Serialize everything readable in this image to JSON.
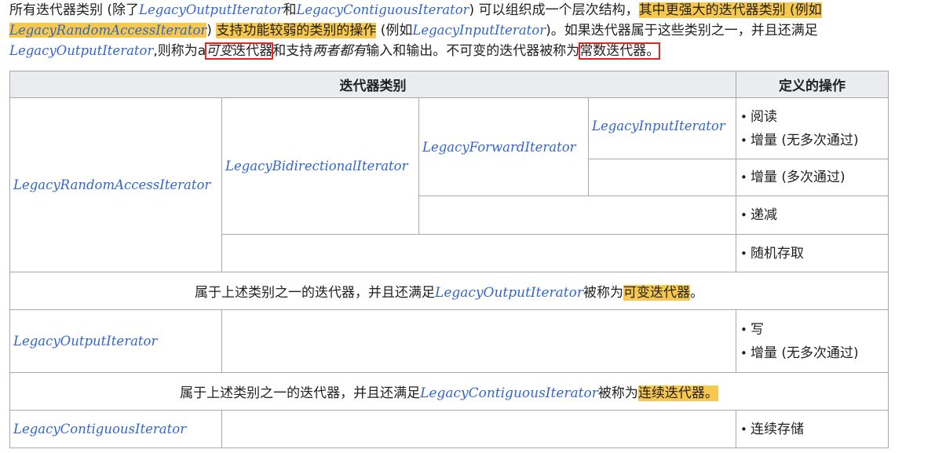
{
  "intro": {
    "t1": "所有迭代器类别 (除了",
    "l1": "LegacyOutputIterator",
    "t2": "和",
    "l2": "LegacyContiguousIterator",
    "t3": ") 可以组织成一个层次结构，",
    "h1": "其中更强大的迭代器类别 (例如",
    "l3": "LegacyRandomAccessIterator",
    "t4": ") ",
    "h2": "支持功能较弱的类别的操作",
    "t5": " (例如",
    "l4": "LegacyInputIterator",
    "t6": ")。如果迭代器属于这些类别之一，并且还满足",
    "l5": "LegacyOutputIterator",
    "t7": ",则称为a",
    "b1_italic": "可变",
    "b1_rest": "迭代器",
    "t8": "和支持",
    "i1": "两者都有",
    "t9": "输入和输出。不可变的迭代器被称为",
    "b2": "常数迭代器。"
  },
  "table": {
    "header_categories": "迭代器类别",
    "header_ops": "定义的操作",
    "random_access": "LegacyRandomAccessIterator",
    "bidirectional": "LegacyBidirectionalIterator",
    "forward": "LegacyForwardIterator",
    "input": "LegacyInputIterator",
    "ops_read": "阅读",
    "ops_inc_single": "增量 (无多次通过)",
    "ops_inc_multi": "增量 (多次通过)",
    "ops_dec": "递减",
    "ops_random": "随机存取",
    "mutable_row": {
      "pre": "属于上述类别之一的迭代器，并且还满足",
      "link": "LegacyOutputIterator",
      "mid": "被称为",
      "hl": "可变迭代器",
      "post": "。"
    },
    "output": "LegacyOutputIterator",
    "ops_write": "写",
    "ops_inc_single_2": "增量 (无多次通过)",
    "contig_row": {
      "pre": "属于上述类别之一的迭代器，并且还满足",
      "link": "LegacyContiguousIterator",
      "mid": "被称为",
      "hl": "连续迭代器。"
    },
    "contiguous": "LegacyContiguousIterator",
    "ops_contig": "连续存储"
  }
}
